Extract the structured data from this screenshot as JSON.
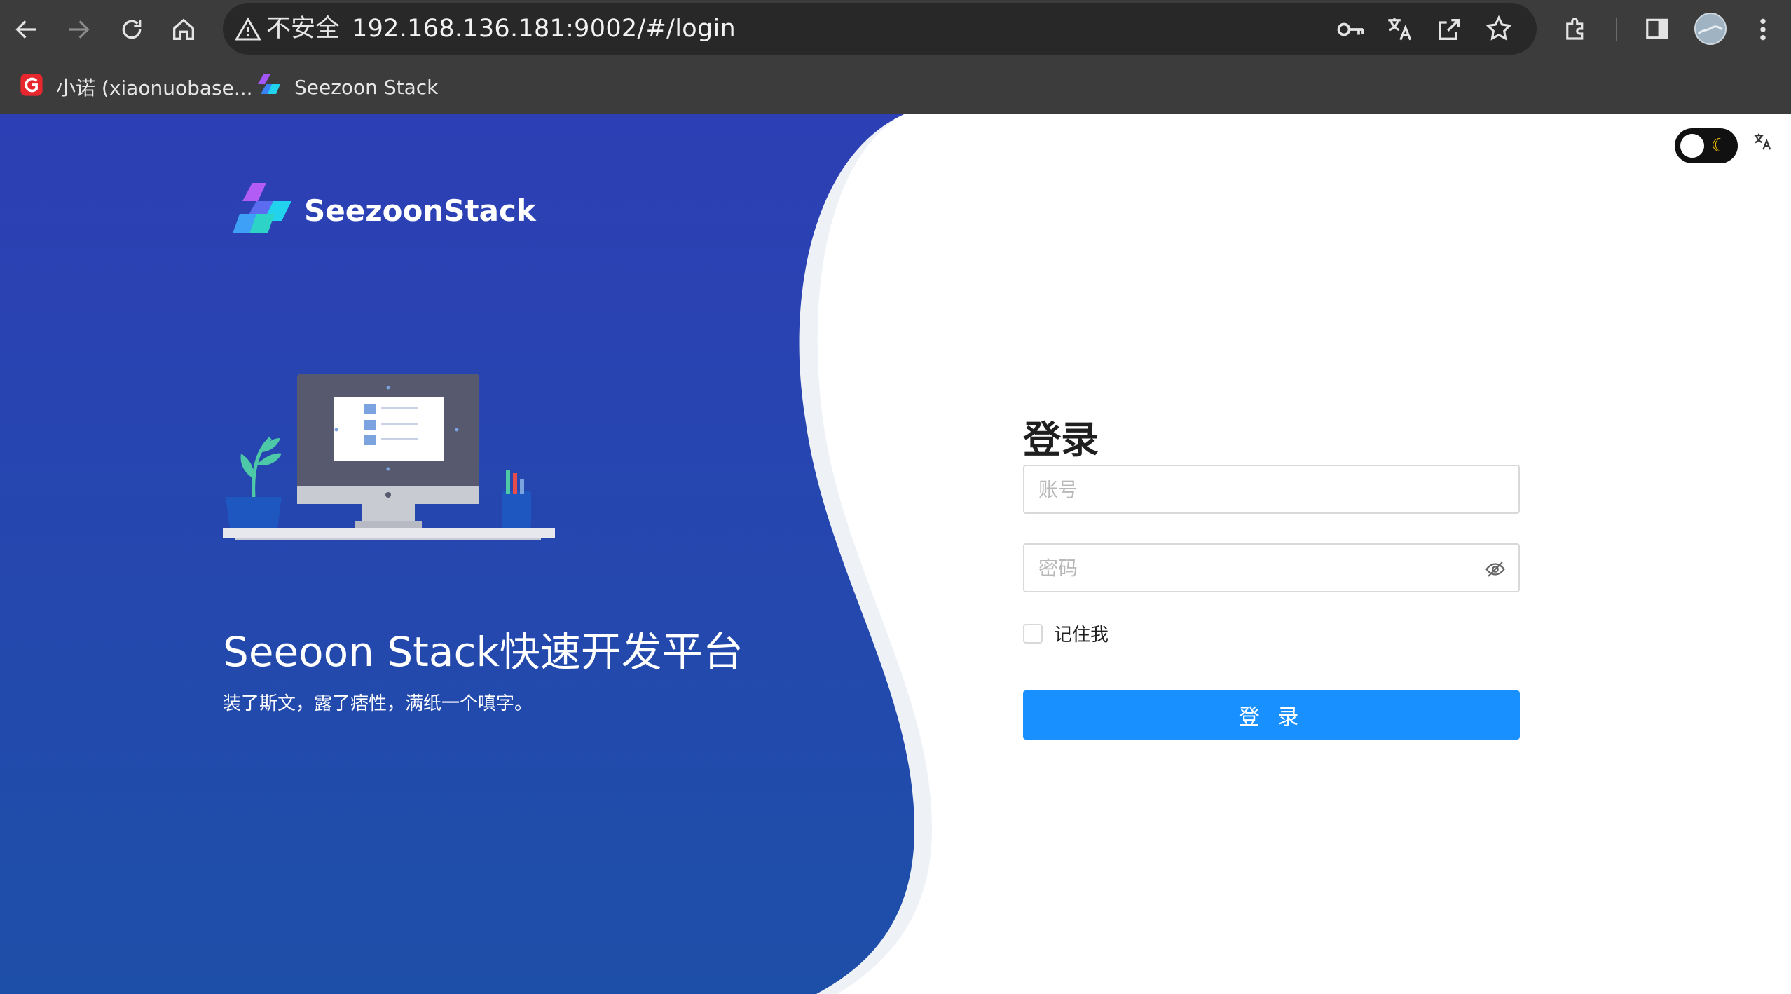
{
  "browser": {
    "security_label": "不安全",
    "url": "192.168.136.181:9002/#/login",
    "bookmarks": [
      {
        "label": "小诺 (xiaonuobase...",
        "icon": "g-logo-icon"
      },
      {
        "label": "Seezoon Stack",
        "icon": "seezoon-logo-icon"
      }
    ]
  },
  "brand": {
    "name": "SeezoonStack"
  },
  "hero": {
    "title": "Seeoon Stack快速开发平台",
    "subtitle": "装了斯文，露了痞性，满纸一个嗔字。"
  },
  "login": {
    "title": "登录",
    "account_placeholder": "账号",
    "password_placeholder": "密码",
    "remember_label": "记住我",
    "submit_label": "登 录"
  },
  "colors": {
    "chrome_bg": "#3c3c3c",
    "left_bg_top": "#2d3fb5",
    "left_bg_bottom": "#1e4ea8",
    "primary": "#1890ff"
  }
}
